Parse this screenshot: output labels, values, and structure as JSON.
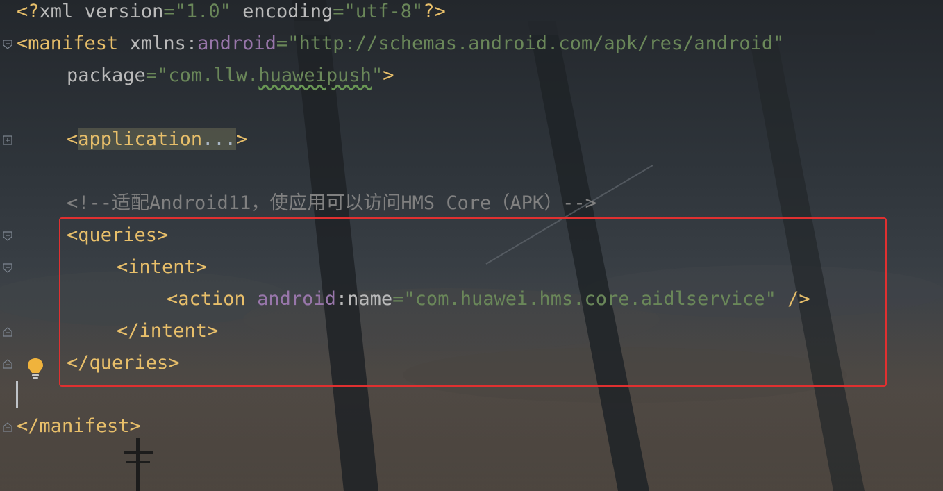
{
  "editor": {
    "lines": {
      "xml_decl": {
        "open": "<?",
        "name": "xml",
        "version_attr": "version",
        "version_val": "\"1.0\"",
        "encoding_attr": "encoding",
        "encoding_val": "\"utf-8\"",
        "close": "?>"
      },
      "manifest_open": {
        "tag": "<manifest",
        "attr_prefix": "xmlns:",
        "ns": "android",
        "eq": "=",
        "val": "\"http://schemas.android.com/apk/res/android\""
      },
      "package": {
        "attr": "package",
        "eq": "=",
        "val_open": "\"com.llw.",
        "val_wavy": "huaweipush",
        "val_close": "\"",
        "end": ">"
      },
      "application": {
        "lt": "<",
        "tag": "application",
        "fold": "...",
        "gt": ">"
      },
      "comment": "<!--适配Android11，使应用可以访问HMS Core（APK）-->",
      "queries_open": "<queries>",
      "intent_open": "<intent>",
      "action": {
        "tag": "<action",
        "ns": "android",
        "colon": ":",
        "attr": "name",
        "eq": "=",
        "val": "\"com.huawei.hms.core.aidlservice\"",
        "end": " />"
      },
      "intent_close": "</intent>",
      "queries_close": "</queries>",
      "manifest_close": "</manifest>"
    }
  },
  "icons": {
    "fold_markers": [
      "fold-open-icon",
      "fold-collapsed-icon",
      "fold-end-icon"
    ],
    "intention": "lightbulb-icon"
  },
  "colors": {
    "tag": "#e8bf6a",
    "string": "#6a8759",
    "namespace": "#9876aa",
    "comment": "#808080",
    "highlight_border": "#e03030",
    "bulb": "#f0b33c"
  }
}
